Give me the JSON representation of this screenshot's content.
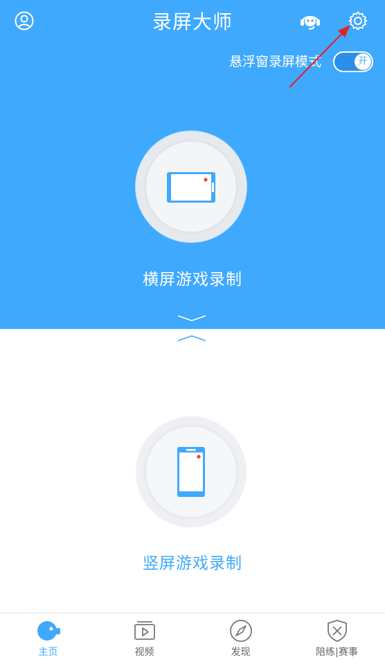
{
  "header": {
    "title": "录屏大师",
    "floating_mode_label": "悬浮窗录屏模式",
    "toggle_state_label": "开"
  },
  "modes": {
    "landscape_label": "横屏游戏录制",
    "portrait_label": "竖屏游戏录制"
  },
  "nav": {
    "items": [
      {
        "label": "主页",
        "icon": "record-camera-icon",
        "active": true
      },
      {
        "label": "视频",
        "icon": "video-play-icon",
        "active": false
      },
      {
        "label": "发现",
        "icon": "compass-icon",
        "active": false
      },
      {
        "label": "陪练|赛事",
        "icon": "shield-swords-icon",
        "active": false
      }
    ]
  },
  "colors": {
    "primary": "#3fa9fd",
    "accent_red": "#f23b3b",
    "annotation_arrow": "#e0242c"
  },
  "icons": {
    "profile": "user-circle-icon",
    "support": "headset-icon",
    "settings": "gear-icon"
  }
}
